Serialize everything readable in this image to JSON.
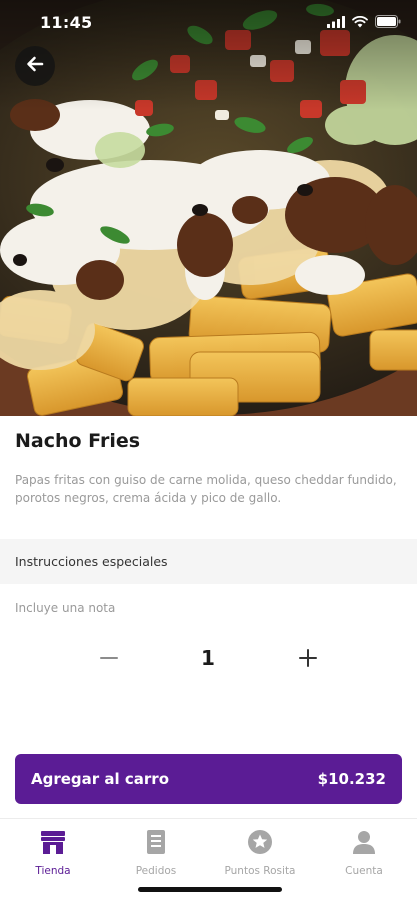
{
  "status_bar": {
    "time": "11:45",
    "icons": [
      "signal-icon",
      "wifi-icon",
      "battery-icon"
    ]
  },
  "navigation": {
    "back_icon": "arrow-left-icon"
  },
  "product": {
    "title": "Nacho Fries",
    "description": "Papas fritas con guiso de carne molida, queso cheddar fundido, porotos negros, crema ácida y pico de gallo."
  },
  "special_instructions": {
    "heading": "Instrucciones especiales",
    "note_placeholder": "Incluye una nota",
    "note_value": ""
  },
  "quantity": {
    "value": "1",
    "decrease_icon": "minus-icon",
    "increase_icon": "plus-icon"
  },
  "cart_button": {
    "label": "Agregar al carro",
    "price": "$10.232"
  },
  "tabbar": {
    "tabs": [
      {
        "label": "Tienda",
        "icon": "store-icon",
        "active": true
      },
      {
        "label": "Pedidos",
        "icon": "receipt-icon",
        "active": false
      },
      {
        "label": "Puntos Rosita",
        "icon": "star-badge-icon",
        "active": false
      },
      {
        "label": "Cuenta",
        "icon": "user-icon",
        "active": false
      }
    ]
  },
  "colors": {
    "brand": "#5b1c95",
    "tab_inactive": "#a6a6a6",
    "section_background": "#f5f5f5",
    "description_text": "#9a9a9a"
  }
}
